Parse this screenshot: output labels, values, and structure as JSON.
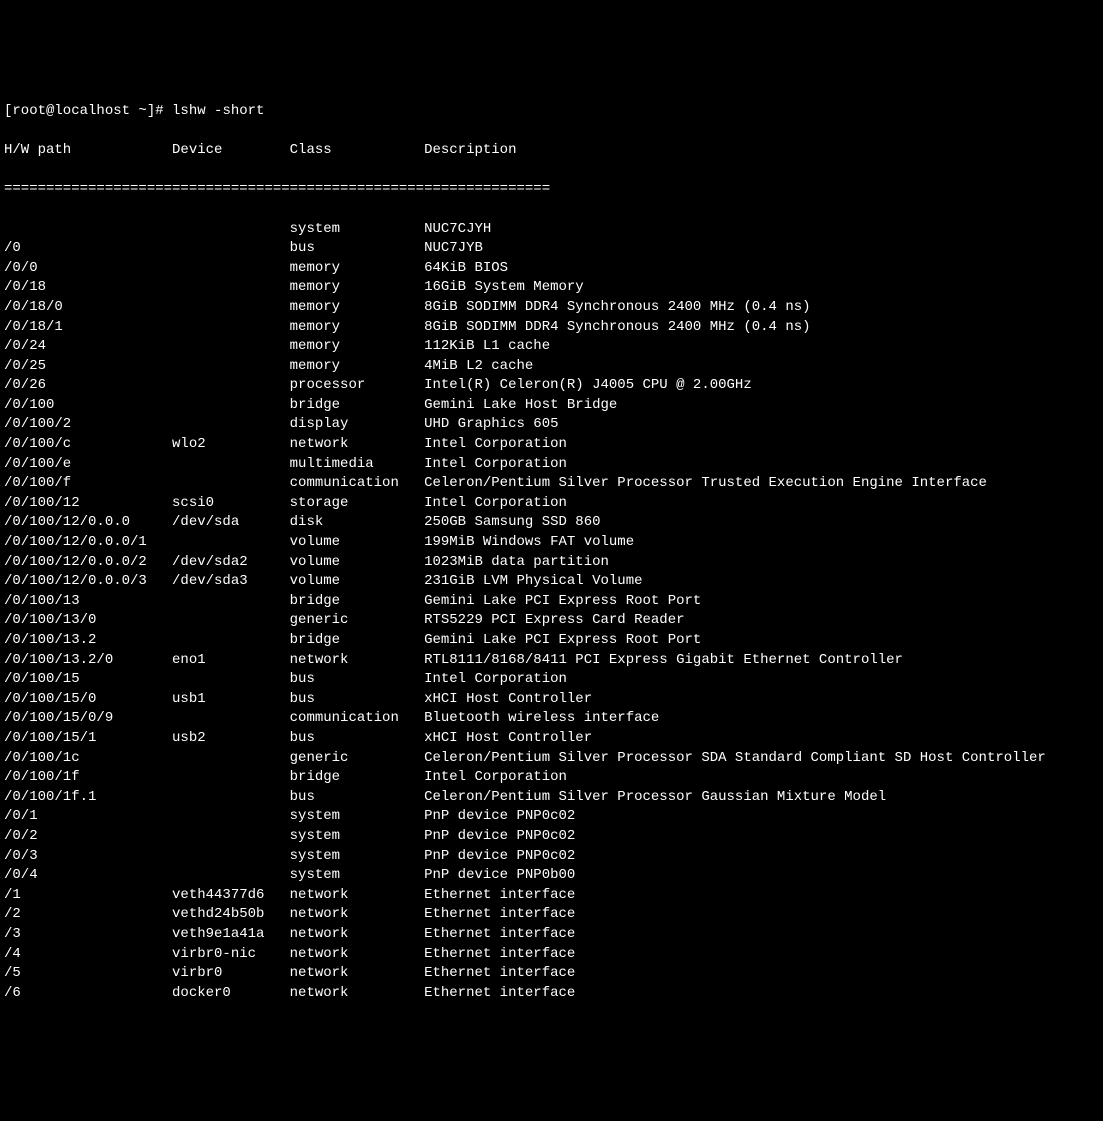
{
  "prompt": "[root@localhost ~]# ",
  "command": "lshw -short",
  "header": {
    "col1": "H/W path",
    "col2": "Device",
    "col3": "Class",
    "col4": "Description"
  },
  "separator": "=================================================================",
  "rows": [
    {
      "path": "",
      "device": "",
      "class": "system",
      "desc": "NUC7CJYH"
    },
    {
      "path": "/0",
      "device": "",
      "class": "bus",
      "desc": "NUC7JYB"
    },
    {
      "path": "/0/0",
      "device": "",
      "class": "memory",
      "desc": "64KiB BIOS"
    },
    {
      "path": "/0/18",
      "device": "",
      "class": "memory",
      "desc": "16GiB System Memory"
    },
    {
      "path": "/0/18/0",
      "device": "",
      "class": "memory",
      "desc": "8GiB SODIMM DDR4 Synchronous 2400 MHz (0.4 ns)"
    },
    {
      "path": "/0/18/1",
      "device": "",
      "class": "memory",
      "desc": "8GiB SODIMM DDR4 Synchronous 2400 MHz (0.4 ns)"
    },
    {
      "path": "/0/24",
      "device": "",
      "class": "memory",
      "desc": "112KiB L1 cache"
    },
    {
      "path": "/0/25",
      "device": "",
      "class": "memory",
      "desc": "4MiB L2 cache"
    },
    {
      "path": "/0/26",
      "device": "",
      "class": "processor",
      "desc": "Intel(R) Celeron(R) J4005 CPU @ 2.00GHz"
    },
    {
      "path": "/0/100",
      "device": "",
      "class": "bridge",
      "desc": "Gemini Lake Host Bridge"
    },
    {
      "path": "/0/100/2",
      "device": "",
      "class": "display",
      "desc": "UHD Graphics 605"
    },
    {
      "path": "/0/100/c",
      "device": "wlo2",
      "class": "network",
      "desc": "Intel Corporation"
    },
    {
      "path": "/0/100/e",
      "device": "",
      "class": "multimedia",
      "desc": "Intel Corporation"
    },
    {
      "path": "/0/100/f",
      "device": "",
      "class": "communication",
      "desc": "Celeron/Pentium Silver Processor Trusted Execution Engine Interface"
    },
    {
      "path": "/0/100/12",
      "device": "scsi0",
      "class": "storage",
      "desc": "Intel Corporation"
    },
    {
      "path": "/0/100/12/0.0.0",
      "device": "/dev/sda",
      "class": "disk",
      "desc": "250GB Samsung SSD 860"
    },
    {
      "path": "/0/100/12/0.0.0/1",
      "device": "",
      "class": "volume",
      "desc": "199MiB Windows FAT volume"
    },
    {
      "path": "/0/100/12/0.0.0/2",
      "device": "/dev/sda2",
      "class": "volume",
      "desc": "1023MiB data partition"
    },
    {
      "path": "/0/100/12/0.0.0/3",
      "device": "/dev/sda3",
      "class": "volume",
      "desc": "231GiB LVM Physical Volume"
    },
    {
      "path": "/0/100/13",
      "device": "",
      "class": "bridge",
      "desc": "Gemini Lake PCI Express Root Port"
    },
    {
      "path": "/0/100/13/0",
      "device": "",
      "class": "generic",
      "desc": "RTS5229 PCI Express Card Reader"
    },
    {
      "path": "/0/100/13.2",
      "device": "",
      "class": "bridge",
      "desc": "Gemini Lake PCI Express Root Port"
    },
    {
      "path": "/0/100/13.2/0",
      "device": "eno1",
      "class": "network",
      "desc": "RTL8111/8168/8411 PCI Express Gigabit Ethernet Controller"
    },
    {
      "path": "/0/100/15",
      "device": "",
      "class": "bus",
      "desc": "Intel Corporation"
    },
    {
      "path": "/0/100/15/0",
      "device": "usb1",
      "class": "bus",
      "desc": "xHCI Host Controller"
    },
    {
      "path": "/0/100/15/0/9",
      "device": "",
      "class": "communication",
      "desc": "Bluetooth wireless interface"
    },
    {
      "path": "/0/100/15/1",
      "device": "usb2",
      "class": "bus",
      "desc": "xHCI Host Controller"
    },
    {
      "path": "/0/100/1c",
      "device": "",
      "class": "generic",
      "desc": "Celeron/Pentium Silver Processor SDA Standard Compliant SD Host Controller"
    },
    {
      "path": "/0/100/1f",
      "device": "",
      "class": "bridge",
      "desc": "Intel Corporation"
    },
    {
      "path": "/0/100/1f.1",
      "device": "",
      "class": "bus",
      "desc": "Celeron/Pentium Silver Processor Gaussian Mixture Model"
    },
    {
      "path": "/0/1",
      "device": "",
      "class": "system",
      "desc": "PnP device PNP0c02"
    },
    {
      "path": "/0/2",
      "device": "",
      "class": "system",
      "desc": "PnP device PNP0c02"
    },
    {
      "path": "/0/3",
      "device": "",
      "class": "system",
      "desc": "PnP device PNP0c02"
    },
    {
      "path": "/0/4",
      "device": "",
      "class": "system",
      "desc": "PnP device PNP0b00"
    },
    {
      "path": "/1",
      "device": "veth44377d6",
      "class": "network",
      "desc": "Ethernet interface"
    },
    {
      "path": "/2",
      "device": "vethd24b50b",
      "class": "network",
      "desc": "Ethernet interface"
    },
    {
      "path": "/3",
      "device": "veth9e1a41a",
      "class": "network",
      "desc": "Ethernet interface"
    },
    {
      "path": "/4",
      "device": "virbr0-nic",
      "class": "network",
      "desc": "Ethernet interface"
    },
    {
      "path": "/5",
      "device": "virbr0",
      "class": "network",
      "desc": "Ethernet interface"
    },
    {
      "path": "/6",
      "device": "docker0",
      "class": "network",
      "desc": "Ethernet interface"
    }
  ],
  "columns": {
    "path_width": 20,
    "device_width": 14,
    "class_width": 16
  }
}
